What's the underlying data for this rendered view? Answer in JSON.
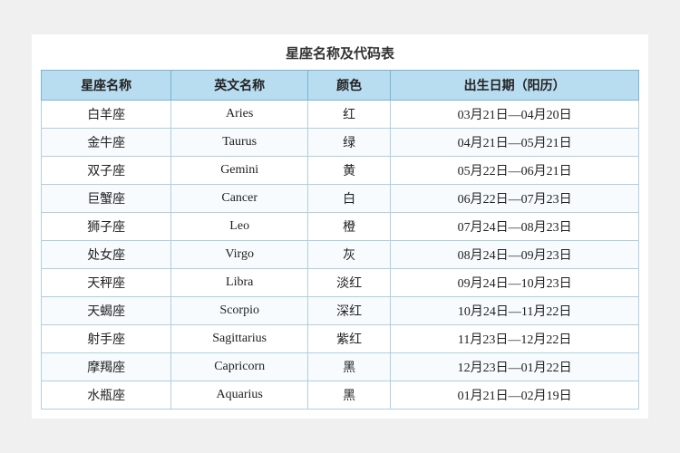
{
  "title": "星座名称及代码表",
  "columns": [
    {
      "key": "chinese_name",
      "label": "星座名称"
    },
    {
      "key": "english_name",
      "label": "英文名称"
    },
    {
      "key": "color",
      "label": "颜色"
    },
    {
      "key": "date_range",
      "label": "出生日期（阳历）"
    }
  ],
  "rows": [
    {
      "chinese_name": "白羊座",
      "english_name": "Aries",
      "color": "红",
      "date_range": "03月21日—04月20日"
    },
    {
      "chinese_name": "金牛座",
      "english_name": "Taurus",
      "color": "绿",
      "date_range": "04月21日—05月21日"
    },
    {
      "chinese_name": "双子座",
      "english_name": "Gemini",
      "color": "黄",
      "date_range": "05月22日—06月21日"
    },
    {
      "chinese_name": "巨蟹座",
      "english_name": "Cancer",
      "color": "白",
      "date_range": "06月22日—07月23日"
    },
    {
      "chinese_name": "狮子座",
      "english_name": "Leo",
      "color": "橙",
      "date_range": "07月24日—08月23日"
    },
    {
      "chinese_name": "处女座",
      "english_name": "Virgo",
      "color": "灰",
      "date_range": "08月24日—09月23日"
    },
    {
      "chinese_name": "天秤座",
      "english_name": "Libra",
      "color": "淡红",
      "date_range": "09月24日—10月23日"
    },
    {
      "chinese_name": "天蝎座",
      "english_name": "Scorpio",
      "color": "深红",
      "date_range": "10月24日—11月22日"
    },
    {
      "chinese_name": "射手座",
      "english_name": "Sagittarius",
      "color": "紫红",
      "date_range": "11月23日—12月22日"
    },
    {
      "chinese_name": "摩羯座",
      "english_name": "Capricorn",
      "color": "黑",
      "date_range": "12月23日—01月22日"
    },
    {
      "chinese_name": "水瓶座",
      "english_name": "Aquarius",
      "color": "黑",
      "date_range": "01月21日—02月19日"
    }
  ]
}
